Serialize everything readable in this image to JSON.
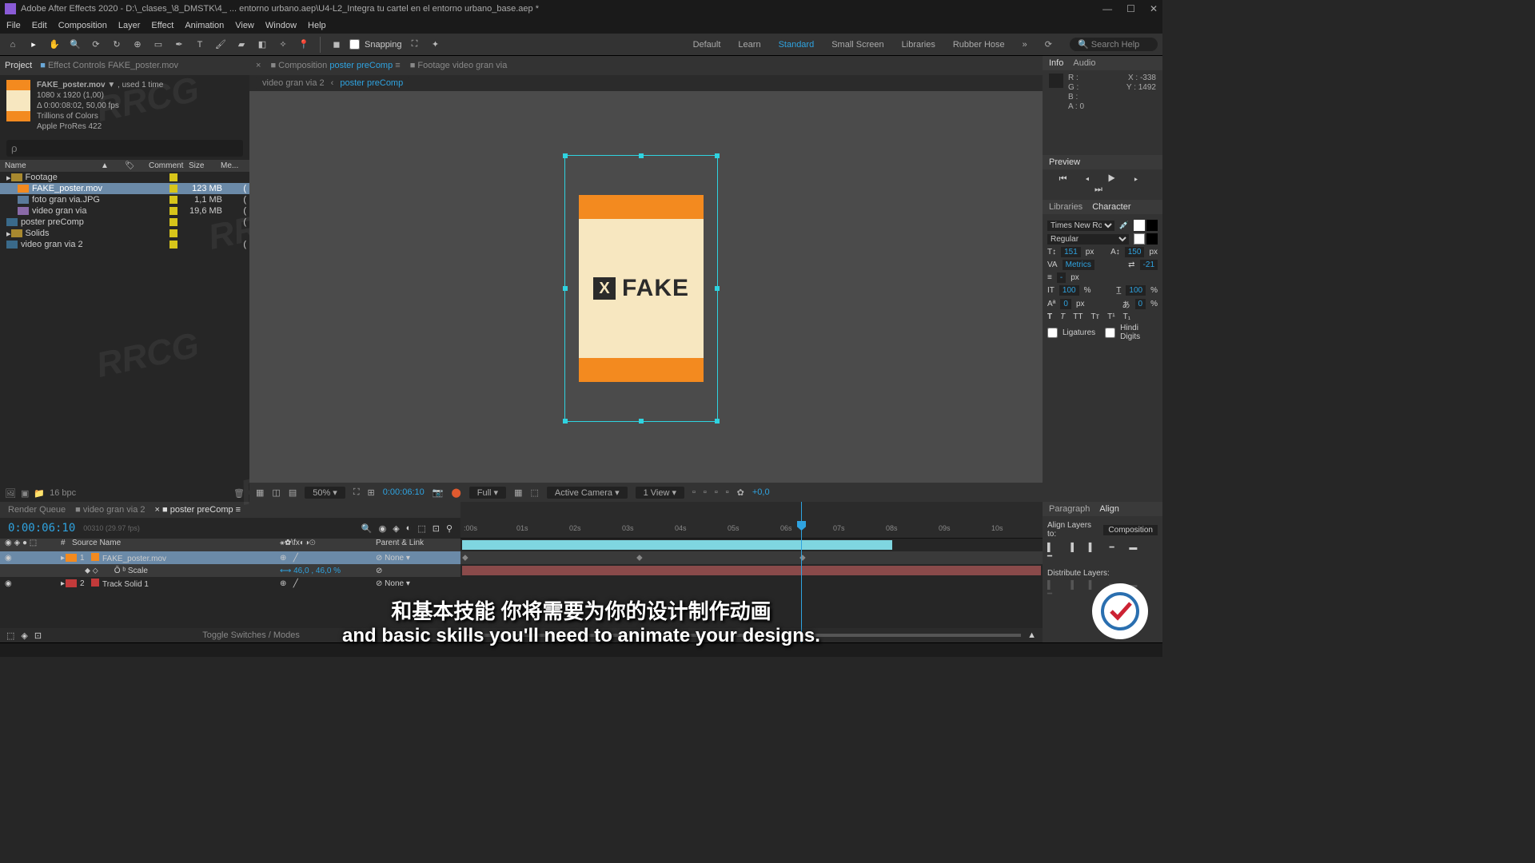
{
  "app": {
    "title_prefix": "Adobe After Effects 2020 - D:\\_clases_\\8_DMSTK\\4_ ... entorno urbano.aep\\U4-L2_Integra tu cartel en el entorno urbano_base.aep *",
    "win_min": "—",
    "win_max": "☐",
    "win_close": "✕"
  },
  "menu": [
    "File",
    "Edit",
    "Composition",
    "Layer",
    "Effect",
    "Animation",
    "View",
    "Window",
    "Help"
  ],
  "toolbar": {
    "snapping": "Snapping",
    "workspaces": [
      "Default",
      "Learn",
      "Standard",
      "Small Screen",
      "Libraries",
      "Rubber Hose"
    ],
    "active_ws": "Standard",
    "search_placeholder": "Search Help"
  },
  "project": {
    "tab_project": "Project",
    "tab_effect": "Effect Controls  FAKE_poster.mov",
    "item_name": "FAKE_poster.mov",
    "used": "used 1 time",
    "dims": "1080 x 1920 (1,00)",
    "dur": "Δ 0:00:08:02, 50,00 fps",
    "colors": "Trillions of Colors",
    "codec": "Apple ProRes 422",
    "search_ph": "ρ",
    "cols": {
      "name": "Name",
      "label": "",
      "comment": "Comment",
      "size": "Size",
      "media": "Me..."
    },
    "tree": [
      {
        "indent": 0,
        "icon": "folder",
        "name": "Footage",
        "size": "",
        "sel": false
      },
      {
        "indent": 1,
        "icon": "mov",
        "name": "FAKE_poster.mov",
        "size": "123 MB",
        "sel": true
      },
      {
        "indent": 1,
        "icon": "img",
        "name": "foto gran via.JPG",
        "size": "1,1 MB",
        "sel": false
      },
      {
        "indent": 1,
        "icon": "mov",
        "name": "video gran via",
        "size": "19,6 MB",
        "sel": false
      },
      {
        "indent": 0,
        "icon": "comp",
        "name": "poster preComp",
        "size": "",
        "sel": false
      },
      {
        "indent": 0,
        "icon": "folder",
        "name": "Solids",
        "size": "",
        "sel": false
      },
      {
        "indent": 0,
        "icon": "comp",
        "name": "video gran via 2",
        "size": "",
        "sel": false
      }
    ],
    "foot_bpc": "16 bpc"
  },
  "comp": {
    "tab_comp_prefix": "Composition",
    "tab_comp_name": "poster preComp",
    "tab_footage": "Footage  video gran via",
    "crumb1": "video gran via 2",
    "crumb2": "poster preComp",
    "poster_text": "FAKE",
    "foot": {
      "zoom": "50%",
      "time": "0:00:06:10",
      "res": "Full",
      "camera": "Active Camera",
      "views": "1 View",
      "exp": "+0,0"
    }
  },
  "info": {
    "tab_info": "Info",
    "tab_audio": "Audio",
    "x": "X : -338",
    "y": "Y : 1492",
    "r": "R :",
    "g": "G :",
    "b": "B :",
    "a": "A : 0"
  },
  "preview": {
    "title": "Preview"
  },
  "libchar": {
    "tab_lib": "Libraries",
    "tab_char": "Character",
    "font": "Times New Roman",
    "style": "Regular",
    "size": "151",
    "size_u": "px",
    "lead": "150",
    "lead_u": "px",
    "kern": "Metrics",
    "track": "-21",
    "stroke": "-",
    "stroke_u": "px",
    "vscale": "100",
    "vscale_u": "%",
    "hscale": "100",
    "hscale_u": "%",
    "baseline": "0",
    "baseline_u": "px",
    "tsume": "0",
    "tsume_u": "%",
    "ligatures": "Ligatures",
    "hindi": "Hindi Digits"
  },
  "timeline": {
    "tabs": {
      "rq": "Render Queue",
      "t1": "video gran via 2",
      "t2": "poster preComp"
    },
    "timecode": "0:00:06:10",
    "frames": "00310 (29.97 fps)",
    "cols": {
      "num": "#",
      "src": "Source Name",
      "parent": "Parent & Link"
    },
    "layers": [
      {
        "num": "1",
        "name": "FAKE_poster.mov",
        "parent": "None",
        "color": "#f38a1f",
        "sel": true
      },
      {
        "prop": "Scale",
        "val": "46,0 , 46,0 %"
      },
      {
        "num": "2",
        "name": "Track Solid 1",
        "parent": "None",
        "color": "#c23a3a",
        "sel": false
      }
    ],
    "ticks": [
      ":00s",
      "01s",
      "02s",
      "03s",
      "04s",
      "05s",
      "06s",
      "07s",
      "08s",
      "09s",
      "10s"
    ],
    "foot": "Toggle Switches / Modes"
  },
  "right2": {
    "tab_para": "Paragraph",
    "tab_align": "Align",
    "align_label": "Align Layers to:",
    "align_to": "Composition",
    "dist": "Distribute Layers:"
  },
  "subtitle": {
    "cn": "和基本技能 你将需要为你的设计制作动画",
    "en": "and basic skills you'll need to animate your designs."
  }
}
